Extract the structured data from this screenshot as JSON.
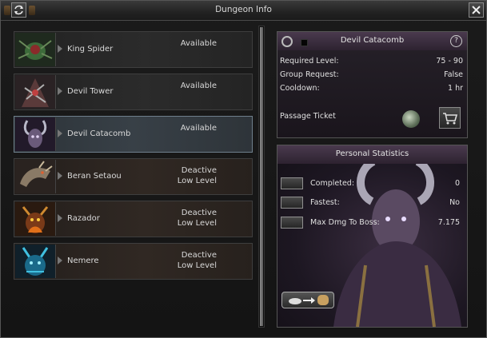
{
  "window": {
    "title": "Dungeon Info"
  },
  "dungeons": [
    {
      "name": "King Spider",
      "status": [
        "Available"
      ],
      "portrait_icon": "spider-portrait",
      "selected": false,
      "available": true
    },
    {
      "name": "Devil Tower",
      "status": [
        "Available"
      ],
      "portrait_icon": "tower-portrait",
      "selected": false,
      "available": true
    },
    {
      "name": "Devil Catacomb",
      "status": [
        "Available"
      ],
      "portrait_icon": "catacomb-portrait",
      "selected": true,
      "available": true
    },
    {
      "name": "Beran Setaou",
      "status": [
        "Deactive",
        "Low Level"
      ],
      "portrait_icon": "dragon-portrait",
      "selected": false,
      "available": false
    },
    {
      "name": "Razador",
      "status": [
        "Deactive",
        "Low Level"
      ],
      "portrait_icon": "fire-demon-portrait",
      "selected": false,
      "available": false
    },
    {
      "name": "Nemere",
      "status": [
        "Deactive",
        "Low Level"
      ],
      "portrait_icon": "ice-demon-portrait",
      "selected": false,
      "available": false
    }
  ],
  "detail": {
    "name": "Devil Catacomb",
    "rows": [
      {
        "label": "Required Level:",
        "value": "75 - 90"
      },
      {
        "label": "Group Request:",
        "value": "False"
      },
      {
        "label": "Cooldown:",
        "value": "1 hr"
      }
    ],
    "ticket_label": "Passage Ticket",
    "help_glyph": "?"
  },
  "stats": {
    "title": "Personal Statistics",
    "rows": [
      {
        "label": "Completed:",
        "value": "0",
        "icon": "crown-icon"
      },
      {
        "label": "Fastest:",
        "value": "No",
        "icon": "clock-icon"
      },
      {
        "label": "Max Dmg To Boss:",
        "value": "7.175",
        "icon": "shield-icon"
      }
    ]
  },
  "colors": {
    "accent_header": "#4a3a4e",
    "selected_row": "#384047",
    "text": "#d9d9d9"
  }
}
